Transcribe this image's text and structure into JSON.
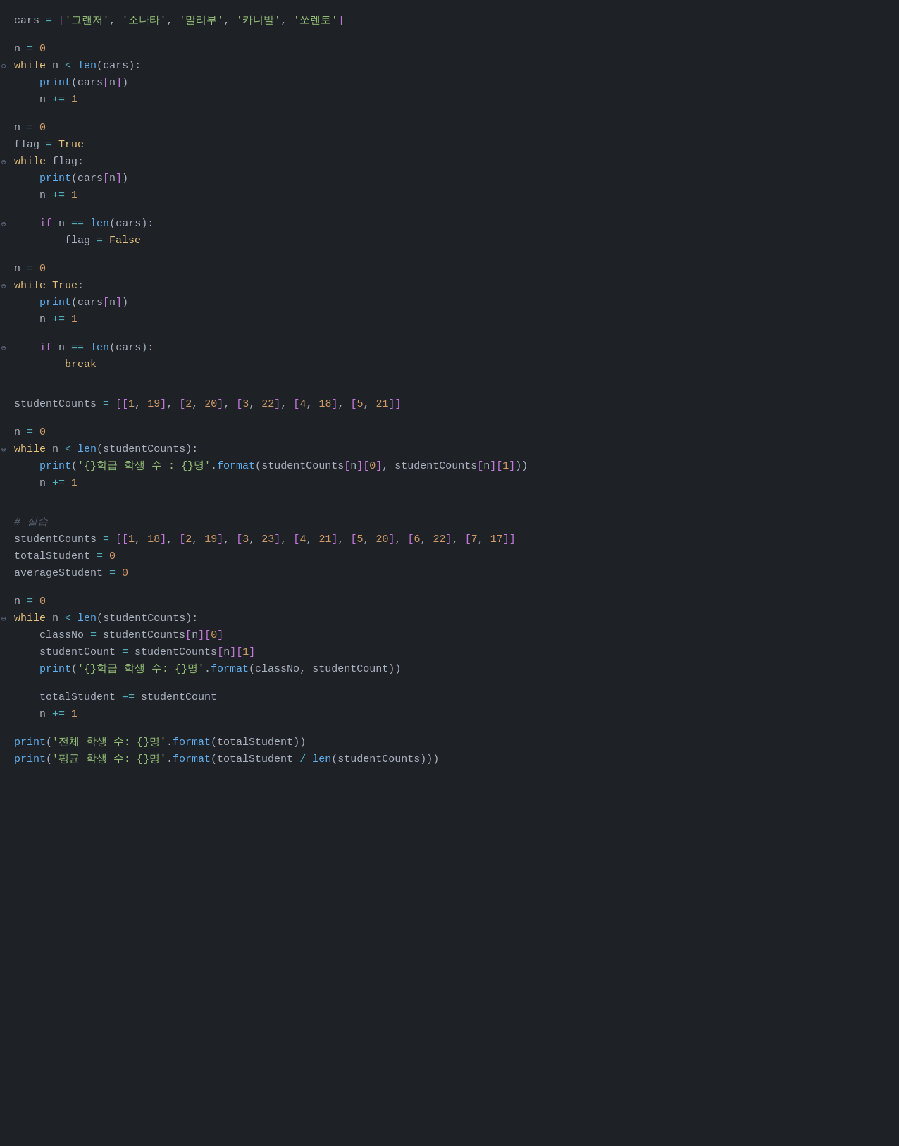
{
  "code": {
    "lines": [
      {
        "id": 1,
        "content": "cars_line",
        "fold": false,
        "separator": false
      },
      {
        "id": 2,
        "content": "blank",
        "fold": false,
        "separator": true
      },
      {
        "id": 3,
        "content": "n_zero_1",
        "fold": false,
        "separator": false
      },
      {
        "id": 4,
        "content": "while_n_lt_len_cars",
        "fold": true,
        "separator": false
      },
      {
        "id": 5,
        "content": "print_cars_n_1",
        "fold": false,
        "separator": false
      },
      {
        "id": 6,
        "content": "n_plus_1_1",
        "fold": false,
        "separator": false
      },
      {
        "id": 7,
        "content": "blank",
        "fold": false,
        "separator": true
      },
      {
        "id": 8,
        "content": "n_zero_2",
        "fold": false,
        "separator": false
      },
      {
        "id": 9,
        "content": "flag_true",
        "fold": false,
        "separator": false
      },
      {
        "id": 10,
        "content": "while_flag",
        "fold": true,
        "separator": false
      },
      {
        "id": 11,
        "content": "print_cars_n_2",
        "fold": false,
        "separator": false
      },
      {
        "id": 12,
        "content": "n_plus_1_2",
        "fold": false,
        "separator": false
      },
      {
        "id": 13,
        "content": "blank",
        "fold": false,
        "separator": true
      },
      {
        "id": 14,
        "content": "if_n_eq_len_cars_1",
        "fold": true,
        "separator": false
      },
      {
        "id": 15,
        "content": "flag_false",
        "fold": false,
        "separator": false
      },
      {
        "id": 16,
        "content": "blank",
        "fold": false,
        "separator": true
      },
      {
        "id": 17,
        "content": "n_zero_3",
        "fold": false,
        "separator": false
      },
      {
        "id": 18,
        "content": "while_true",
        "fold": true,
        "separator": false
      },
      {
        "id": 19,
        "content": "print_cars_n_3",
        "fold": false,
        "separator": false
      },
      {
        "id": 20,
        "content": "n_plus_1_3",
        "fold": false,
        "separator": false
      },
      {
        "id": 21,
        "content": "blank",
        "fold": false,
        "separator": true
      },
      {
        "id": 22,
        "content": "if_n_eq_len_cars_2",
        "fold": true,
        "separator": false
      },
      {
        "id": 23,
        "content": "break_line",
        "fold": false,
        "separator": false
      },
      {
        "id": 24,
        "content": "blank",
        "fold": false,
        "separator": true
      },
      {
        "id": 25,
        "content": "blank2",
        "fold": false,
        "separator": true
      },
      {
        "id": 26,
        "content": "student_counts_line",
        "fold": false,
        "separator": false
      },
      {
        "id": 27,
        "content": "blank",
        "fold": false,
        "separator": true
      },
      {
        "id": 28,
        "content": "n_zero_4",
        "fold": false,
        "separator": false
      },
      {
        "id": 29,
        "content": "while_n_lt_len_sc",
        "fold": true,
        "separator": false
      },
      {
        "id": 30,
        "content": "print_format_1",
        "fold": false,
        "separator": false
      },
      {
        "id": 31,
        "content": "n_plus_1_4",
        "fold": false,
        "separator": false
      },
      {
        "id": 32,
        "content": "blank",
        "fold": false,
        "separator": true
      },
      {
        "id": 33,
        "content": "blank",
        "fold": false,
        "separator": true
      },
      {
        "id": 34,
        "content": "comment_seuseup",
        "fold": false,
        "separator": false
      },
      {
        "id": 35,
        "content": "student_counts_2",
        "fold": false,
        "separator": false
      },
      {
        "id": 36,
        "content": "total_student",
        "fold": false,
        "separator": false
      },
      {
        "id": 37,
        "content": "average_student",
        "fold": false,
        "separator": false
      },
      {
        "id": 38,
        "content": "blank",
        "fold": false,
        "separator": true
      },
      {
        "id": 39,
        "content": "n_zero_5",
        "fold": false,
        "separator": false
      },
      {
        "id": 40,
        "content": "while_n_lt_len_sc2",
        "fold": true,
        "separator": false
      },
      {
        "id": 41,
        "content": "class_no",
        "fold": false,
        "separator": false
      },
      {
        "id": 42,
        "content": "student_count_var",
        "fold": false,
        "separator": false
      },
      {
        "id": 43,
        "content": "print_format_2",
        "fold": false,
        "separator": false
      },
      {
        "id": 44,
        "content": "blank",
        "fold": false,
        "separator": true
      },
      {
        "id": 45,
        "content": "total_plus_sc",
        "fold": false,
        "separator": false
      },
      {
        "id": 46,
        "content": "n_plus_1_5",
        "fold": false,
        "separator": false
      },
      {
        "id": 47,
        "content": "blank",
        "fold": false,
        "separator": true
      },
      {
        "id": 48,
        "content": "print_total",
        "fold": false,
        "separator": false
      },
      {
        "id": 49,
        "content": "print_avg",
        "fold": false,
        "separator": false
      }
    ]
  }
}
